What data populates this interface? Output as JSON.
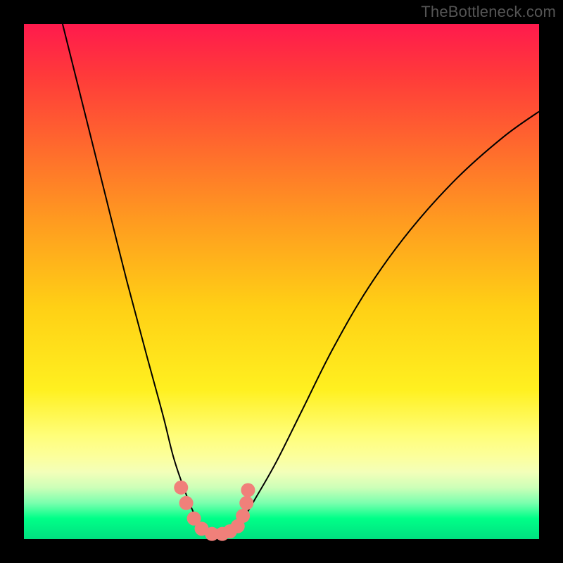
{
  "watermark": "TheBottleneck.com",
  "chart_data": {
    "type": "line",
    "title": "",
    "xlabel": "",
    "ylabel": "",
    "xlim": [
      0,
      100
    ],
    "ylim": [
      0,
      100
    ],
    "grid": false,
    "legend": false,
    "annotations": [],
    "series": [
      {
        "name": "left-branch",
        "color": "#000000",
        "x": [
          7.5,
          12,
          16,
          20,
          24,
          27,
          29,
          31,
          33,
          34.5,
          36
        ],
        "values": [
          100,
          82,
          66,
          50,
          35,
          24,
          16,
          10,
          5,
          2.5,
          1
        ]
      },
      {
        "name": "right-branch",
        "color": "#000000",
        "x": [
          40,
          42,
          45,
          49,
          54,
          60,
          67,
          75,
          84,
          93,
          100
        ],
        "values": [
          1,
          3,
          8,
          15,
          25,
          37,
          49,
          60,
          70,
          78,
          83
        ]
      },
      {
        "name": "bottom-markers",
        "color": "#f0807a",
        "marker_radius_px": 10,
        "x": [
          30.5,
          31.5,
          33.0,
          34.5,
          36.5,
          38.5,
          40.0,
          41.5,
          42.5,
          43.2,
          43.5
        ],
        "values": [
          10.0,
          7.0,
          4.0,
          2.0,
          1.0,
          1.0,
          1.5,
          2.5,
          4.5,
          7.0,
          9.5
        ]
      }
    ],
    "gradient_colors": {
      "top": "#ff1a4d",
      "mid": "#fff020",
      "bottom": "#00ff88"
    }
  }
}
